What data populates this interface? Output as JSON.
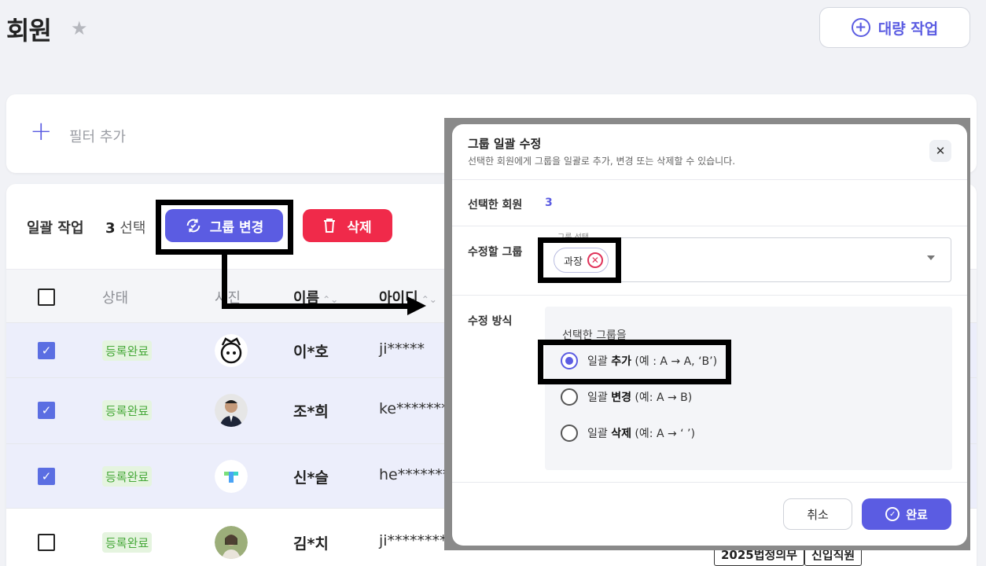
{
  "header": {
    "title": "회원",
    "bulk_action_label": "대량 작업"
  },
  "filter": {
    "add_label": "필터 추가"
  },
  "toolbar": {
    "bulk_label": "일괄 작업",
    "selected_count": "3",
    "selected_suffix": "선택",
    "group_change_label": "그룹 변경",
    "delete_label": "삭제"
  },
  "table": {
    "columns": [
      "상태",
      "사진",
      "이름",
      "아이디"
    ],
    "rows": [
      {
        "status": "등록완료",
        "name": "이*호",
        "id": "ji*****",
        "checked": true
      },
      {
        "status": "등록완료",
        "name": "조*희",
        "id": "ke*******",
        "checked": true
      },
      {
        "status": "등록완료",
        "name": "신*슬",
        "id": "he*******",
        "checked": true
      },
      {
        "status": "등록완료",
        "name": "김*치",
        "id": "ji********",
        "checked": false
      }
    ],
    "tags": [
      "2025법정의무",
      "신입직원"
    ]
  },
  "modal": {
    "title": "그룹 일괄 수정",
    "subtitle": "선택한 회원에게 그룹을 일괄로 추가, 변경 또는 삭제할 수 있습니다.",
    "selected_members_label": "선택한 회원",
    "selected_members_count": "3",
    "target_group_label": "수정할 그룹",
    "group_select_legend": "그룹 선택",
    "chips": [
      "과장"
    ],
    "method_label": "수정 방식",
    "method_title": "선택한 그룹을",
    "options": [
      {
        "prefix": "일괄 ",
        "bold": "추가",
        "suffix": " (예 : A → A, ‘B’)",
        "selected": true
      },
      {
        "prefix": "일괄 ",
        "bold": "변경",
        "suffix": " (예: A → B)",
        "selected": false
      },
      {
        "prefix": "일괄 ",
        "bold": "삭제",
        "suffix": " (예: A → ‘ ’)",
        "selected": false
      }
    ],
    "cancel_label": "취소",
    "confirm_label": "완료"
  },
  "colors": {
    "accent": "#5b5ce2",
    "danger": "#f02a4a",
    "status_bg": "#e5f4df",
    "status_text": "#47a93a"
  }
}
